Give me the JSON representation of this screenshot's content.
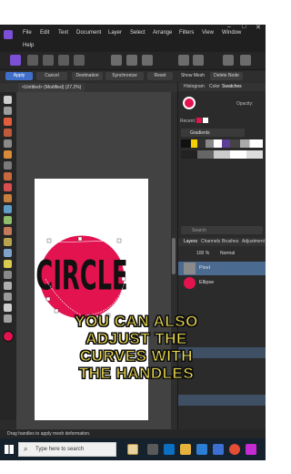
{
  "menu": {
    "items": [
      "File",
      "Edit",
      "Text",
      "Document",
      "Layer",
      "Select",
      "Arrange",
      "Filters",
      "View",
      "Window"
    ],
    "help": "Help"
  },
  "context_toolbar": {
    "apply": "Apply",
    "cancel": "Cancel",
    "destination": "Destination",
    "synchronize": "Synchronize",
    "reset": "Reset",
    "show_mesh": "Show Mesh",
    "delete_node": "Delete Node"
  },
  "document_tab": "<Untitled> (Modified) (27.2%)",
  "canvas_text": "CIRCLE",
  "panel": {
    "top_tabs": [
      "Histogram",
      "Color",
      "Swatches"
    ],
    "opacity_label": "Opacity:",
    "recent_label": "Recent:",
    "gradients_label": "Gradients",
    "search_placeholder": "Search",
    "layer_tabs": [
      "Layers",
      "Channels",
      "Brushes",
      "Adjustment"
    ],
    "layer_opacity": "100 %",
    "blend_mode": "Normal",
    "layers": [
      {
        "name": "Pixel",
        "selected": true
      },
      {
        "name": "Ellipse",
        "selected": false
      }
    ]
  },
  "status_text": "Drag handles to apply mesh deformation.",
  "taskbar": {
    "search_placeholder": "Type here to search"
  },
  "caption_lines": [
    "YOU CAN ALSO",
    "ADJUST THE",
    "CURVES WITH",
    "THE HANDLES"
  ],
  "colors": {
    "accent": "#3f6fc9",
    "ellipse_fill": "#e2134f",
    "caption": "#f6e24a"
  }
}
